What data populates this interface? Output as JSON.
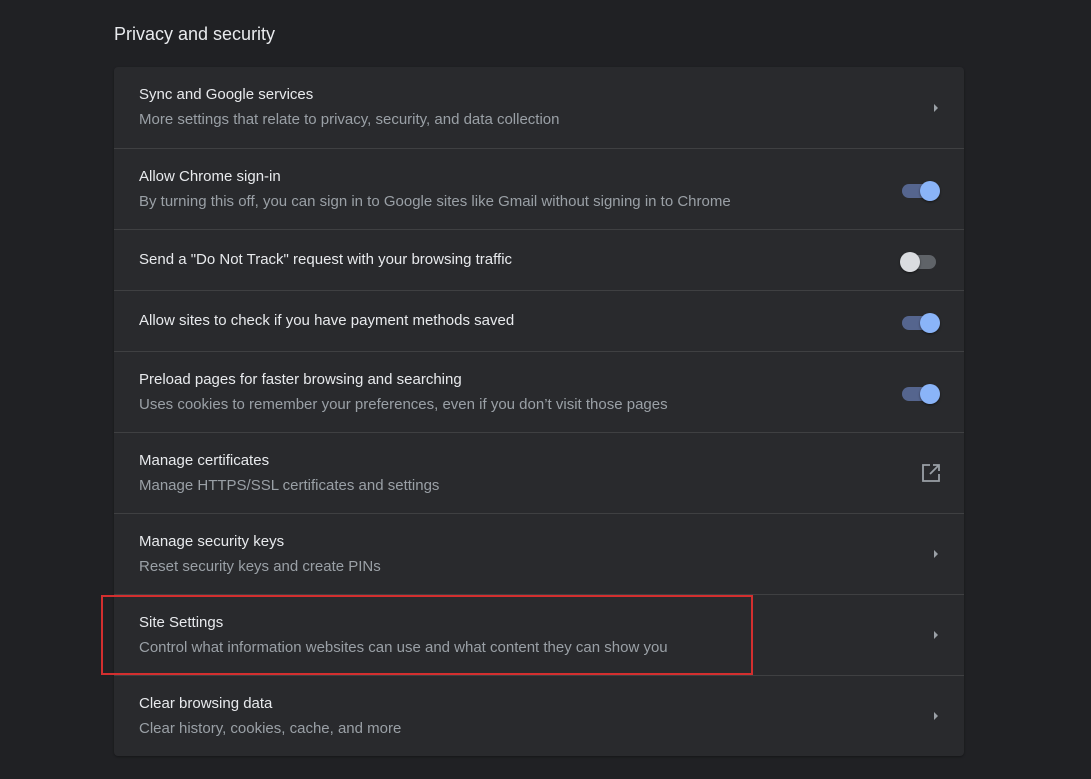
{
  "section": {
    "title": "Privacy and security"
  },
  "rows": [
    {
      "title": "Sync and Google services",
      "subtitle": "More settings that relate to privacy, security, and data collection",
      "action": "chevron-right-icon"
    },
    {
      "title": "Allow Chrome sign-in",
      "subtitle": "By turning this off, you can sign in to Google sites like Gmail without signing in to Chrome",
      "action": "toggle",
      "toggle_on": true
    },
    {
      "title": "Send a \"Do Not Track\" request with your browsing traffic",
      "action": "toggle",
      "toggle_on": false
    },
    {
      "title": "Allow sites to check if you have payment methods saved",
      "action": "toggle",
      "toggle_on": true
    },
    {
      "title": "Preload pages for faster browsing and searching",
      "subtitle": "Uses cookies to remember your preferences, even if you don’t visit those pages",
      "action": "toggle",
      "toggle_on": true
    },
    {
      "title": "Manage certificates",
      "subtitle": "Manage HTTPS/SSL certificates and settings",
      "action": "external-link-icon"
    },
    {
      "title": "Manage security keys",
      "subtitle": "Reset security keys and create PINs",
      "action": "chevron-right-icon"
    },
    {
      "title": "Site Settings",
      "subtitle": "Control what information websites can use and what content they can show you",
      "action": "chevron-right-icon",
      "highlighted": true
    },
    {
      "title": "Clear browsing data",
      "subtitle": "Clear history, cookies, cache, and more",
      "action": "chevron-right-icon"
    }
  ],
  "colors": {
    "background": "#202124",
    "card": "#292a2d",
    "accent": "#8ab4f8",
    "highlight_border": "#d32f2f"
  }
}
